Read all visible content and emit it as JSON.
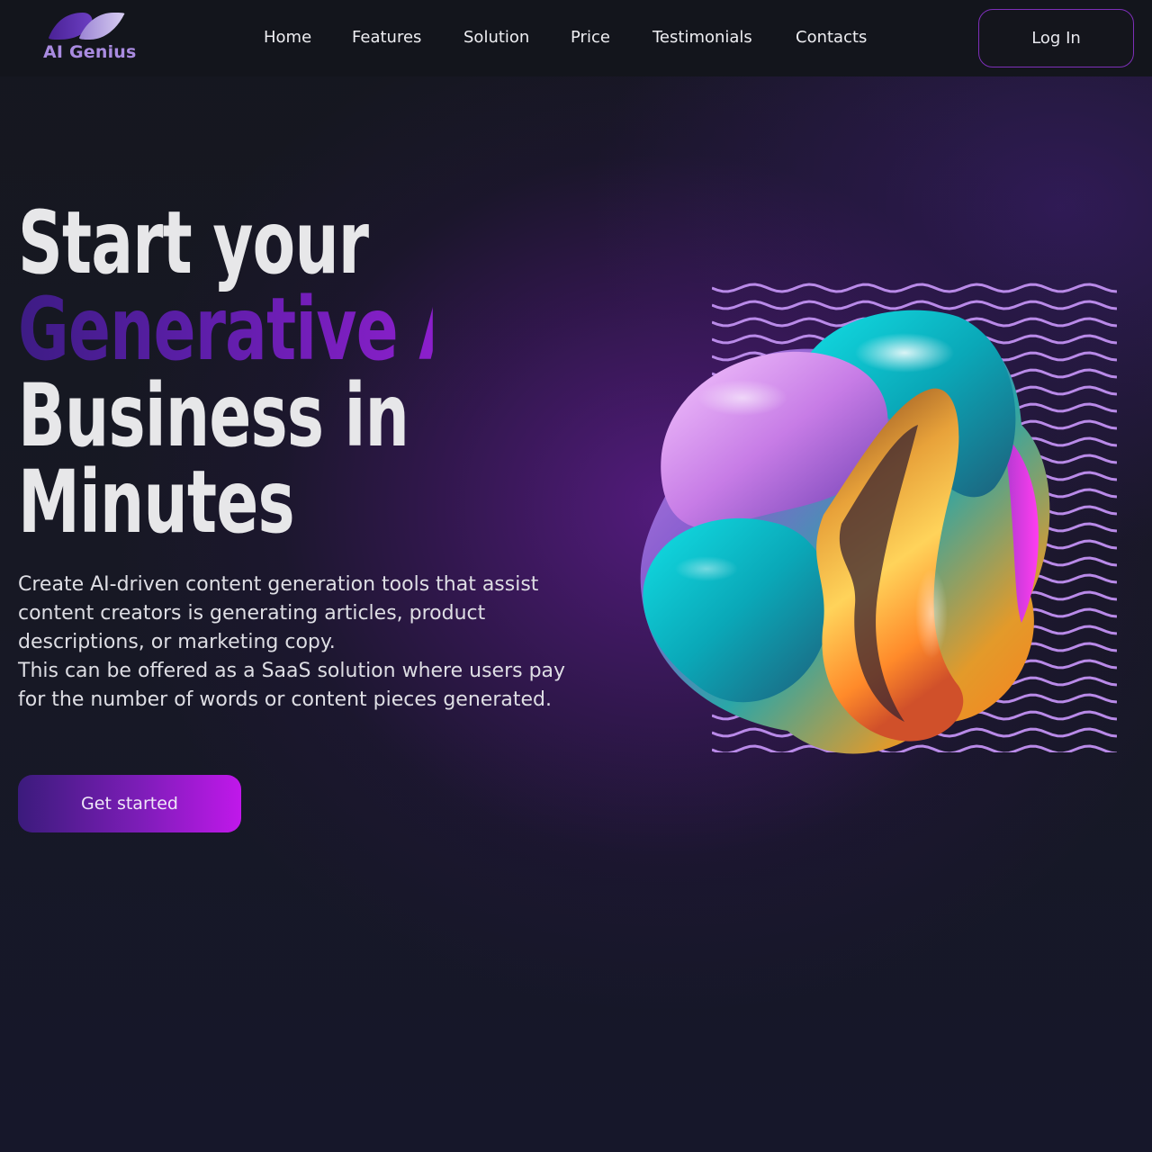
{
  "brand": {
    "name": "AI Genius"
  },
  "nav": {
    "links": [
      "Home",
      "Features",
      "Solution",
      "Price",
      "Testimonials",
      "Contacts"
    ],
    "login_label": "Log In"
  },
  "hero": {
    "headline": [
      "Start your",
      "Generative AI",
      "Business in",
      "Minutes"
    ],
    "description": [
      "Create AI-driven content generation tools that assist content creators is generating articles, product descriptions, or marketing copy.",
      "This can be offered as a SaaS solution where users pay for the number of words or content pieces generated."
    ],
    "cta_label": "Get started"
  },
  "colors": {
    "background": "#15171f",
    "nav_background": "#13151c",
    "accent_start": "#3d1c84",
    "accent_end": "#c018ea",
    "logo_text": "#a98be0",
    "wave_lines": "#b98ae8"
  },
  "icons": {
    "logo": "ai-genius-logo-icon",
    "hero_art": "iridescent-blob-graphic"
  }
}
